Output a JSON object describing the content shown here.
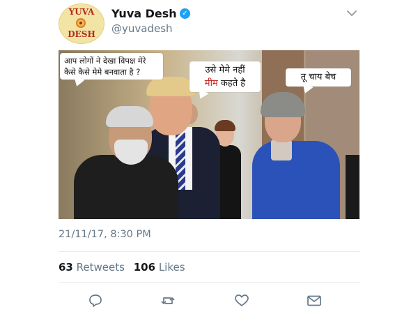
{
  "account": {
    "avatar_text_top": "YUVA",
    "avatar_text_bottom": "DESH",
    "display_name": "Yuva Desh",
    "handle": "@yuvadesh",
    "verified": true
  },
  "meme": {
    "bubble_modi": "आप लोगों ने देखा विपक्ष मेरे कैसे कैसे मेमे बनवाता है ?",
    "bubble_trump_line1": "उसे मेमे नहीं",
    "bubble_trump_line2_red": "मीम",
    "bubble_trump_line2_rest": " कहते है",
    "bubble_may": "तू चाय बेच"
  },
  "tweet": {
    "timestamp": "21/11/17, 8:30 PM",
    "retweets_count": "63",
    "retweets_label": "Retweets",
    "likes_count": "106",
    "likes_label": "Likes"
  },
  "icons": {
    "verified": "verified-badge-icon",
    "menu": "chevron-down-icon",
    "reply": "reply-icon",
    "retweet": "retweet-icon",
    "like": "heart-icon",
    "dm": "envelope-icon"
  },
  "colors": {
    "twitter_blue": "#1da1f2",
    "secondary_text": "#657786",
    "primary_text": "#14171a",
    "meme_red_text": "#c0201b"
  }
}
